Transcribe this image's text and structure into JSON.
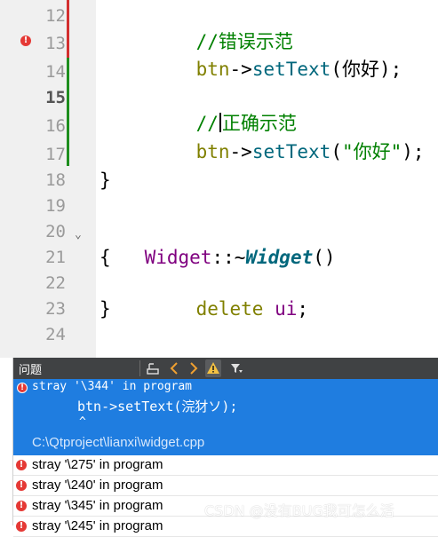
{
  "editor": {
    "lines": [
      {
        "n": "12",
        "bold": false
      },
      {
        "n": "13",
        "bold": false
      },
      {
        "n": "14",
        "bold": false
      },
      {
        "n": "15",
        "bold": true
      },
      {
        "n": "16",
        "bold": false
      },
      {
        "n": "17",
        "bold": false
      },
      {
        "n": "18",
        "bold": false
      },
      {
        "n": "19",
        "bold": false
      },
      {
        "n": "20",
        "bold": false
      },
      {
        "n": "21",
        "bold": false
      },
      {
        "n": "22",
        "bold": false
      },
      {
        "n": "23",
        "bold": false
      },
      {
        "n": "24",
        "bold": false
      }
    ],
    "code": {
      "l12_comment": "//错误示范",
      "l13_obj": "btn",
      "l13_arrow": "->",
      "l13_method": "setText",
      "l13_args": "(你好);",
      "l15_comment_a": "//",
      "l15_comment_b": "正确示范",
      "l16_obj": "btn",
      "l16_arrow": "->",
      "l16_method": "setText",
      "l16_open": "(",
      "l16_string": "\"你好\"",
      "l16_close": ");",
      "l18": "}",
      "l20_class": "Widget",
      "l20_scope": "::~",
      "l20_dtor": "Widget",
      "l20_parens": "()",
      "l21": "{",
      "l22_kw": "delete",
      "l22_var": "ui",
      "l22_semi": ";",
      "l23": "}"
    },
    "error_marker": "!",
    "fold_marker": "⌄"
  },
  "issues_panel": {
    "title": "问题",
    "selected": {
      "message": "stray '\\344' in program",
      "code_line": "btn->setText(浣犲ソ);",
      "caret": "^",
      "path": "C:\\Qtproject\\lianxi\\widget.cpp"
    },
    "items": [
      "stray '\\275' in program",
      "stray '\\240' in program",
      "stray '\\345' in program",
      "stray '\\245' in program"
    ]
  },
  "watermark": "CSDN @没有BUG我可怎么活",
  "colors": {
    "selection": "#1f7de0",
    "error": "#e53935",
    "toolbar": "#404244",
    "modified_bar": "#1e8e1e",
    "error_bar": "#d32f2f"
  },
  "icons": [
    "error-icon",
    "filter-build-icon",
    "arrow-left-icon",
    "arrow-right-icon",
    "warning-icon",
    "filter-icon",
    "fold-icon"
  ]
}
